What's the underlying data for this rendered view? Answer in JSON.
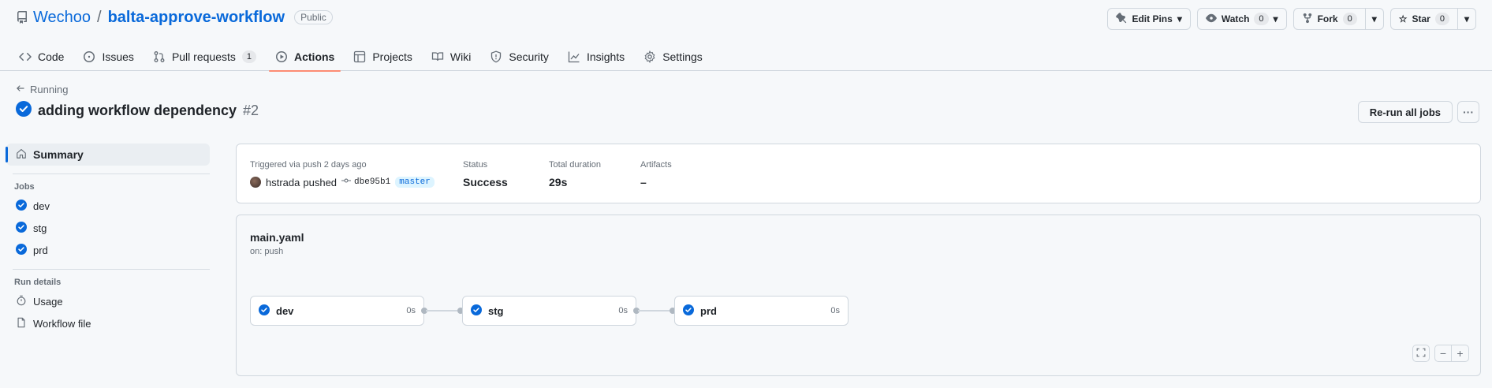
{
  "repo": {
    "owner": "Wechoo",
    "separator": "/",
    "name": "balta-approve-workflow",
    "visibility": "Public"
  },
  "header_actions": {
    "edit_pins": "Edit Pins",
    "watch": {
      "label": "Watch",
      "count": "0"
    },
    "fork": {
      "label": "Fork",
      "count": "0"
    },
    "star": {
      "label": "Star",
      "count": "0"
    }
  },
  "tabs": [
    {
      "label": "Code",
      "icon": "code-icon"
    },
    {
      "label": "Issues",
      "icon": "issue-opened-icon"
    },
    {
      "label": "Pull requests",
      "icon": "git-pull-request-icon",
      "count": "1"
    },
    {
      "label": "Actions",
      "icon": "play-icon",
      "active": true
    },
    {
      "label": "Projects",
      "icon": "table-icon"
    },
    {
      "label": "Wiki",
      "icon": "book-icon"
    },
    {
      "label": "Security",
      "icon": "shield-icon"
    },
    {
      "label": "Insights",
      "icon": "graph-icon"
    },
    {
      "label": "Settings",
      "icon": "gear-icon"
    }
  ],
  "run": {
    "back_label": "Running",
    "title": "adding workflow dependency",
    "number": "#2",
    "rerun_label": "Re-run all jobs",
    "more_label": "···"
  },
  "sidebar": {
    "summary_label": "Summary",
    "jobs_heading": "Jobs",
    "jobs": [
      {
        "label": "dev"
      },
      {
        "label": "stg"
      },
      {
        "label": "prd"
      }
    ],
    "details_heading": "Run details",
    "details": [
      {
        "label": "Usage",
        "icon": "stopwatch-icon"
      },
      {
        "label": "Workflow file",
        "icon": "file-icon"
      }
    ]
  },
  "summary": {
    "trigger_label": "Triggered via push 2 days ago",
    "actor": "hstrada",
    "action": "pushed",
    "commit": "dbe95b1",
    "branch": "master",
    "status_label": "Status",
    "status_value": "Success",
    "duration_label": "Total duration",
    "duration_value": "29s",
    "artifacts_label": "Artifacts",
    "artifacts_value": "–"
  },
  "workflow": {
    "file": "main.yaml",
    "on": "on: push",
    "jobs": [
      {
        "name": "dev",
        "duration": "0s"
      },
      {
        "name": "stg",
        "duration": "0s"
      },
      {
        "name": "prd",
        "duration": "0s"
      }
    ],
    "zoom_minus": "−",
    "zoom_plus": "+"
  },
  "colors": {
    "accent": "#0969da",
    "success": "#0969da",
    "tab_underline": "#fd8c73"
  }
}
